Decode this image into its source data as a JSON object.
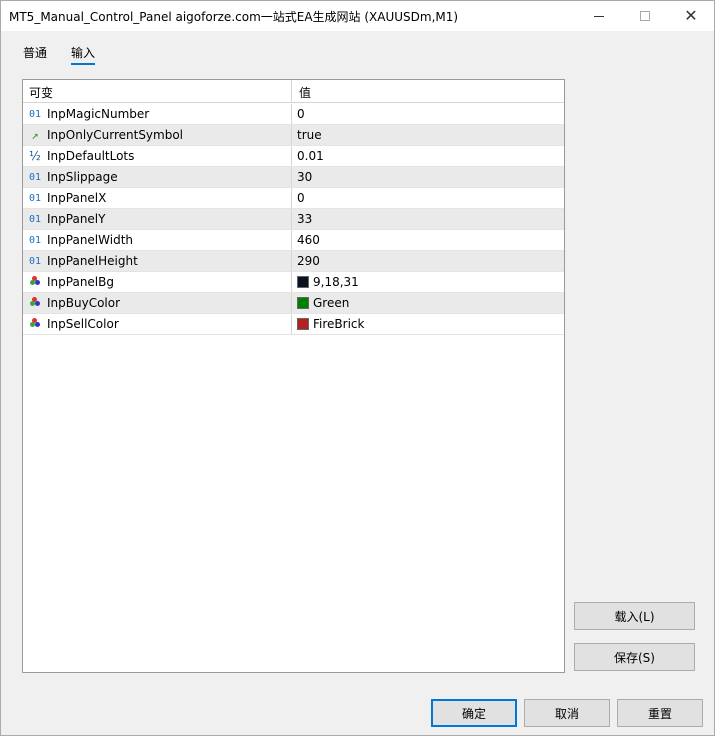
{
  "window": {
    "title": "MT5_Manual_Control_Panel aigoforze.com一站式EA生成网站 (XAUUSDm,M1)",
    "close_glyph": "✕"
  },
  "tabs": [
    {
      "label": "普通",
      "active": false
    },
    {
      "label": "输入",
      "active": true
    }
  ],
  "grid": {
    "headers": {
      "name": "可变",
      "value": "值"
    },
    "rows": [
      {
        "type_icon": "01",
        "icon_name": "integer-icon",
        "name": "InpMagicNumber",
        "value": "0"
      },
      {
        "type_icon": "↗",
        "icon_name": "boolean-icon",
        "name": "InpOnlyCurrentSymbol",
        "value": "true"
      },
      {
        "type_icon": "½",
        "icon_name": "double-icon",
        "name": "InpDefaultLots",
        "value": "0.01"
      },
      {
        "type_icon": "01",
        "icon_name": "integer-icon",
        "name": "InpSlippage",
        "value": "30"
      },
      {
        "type_icon": "01",
        "icon_name": "integer-icon",
        "name": "InpPanelX",
        "value": "0"
      },
      {
        "type_icon": "01",
        "icon_name": "integer-icon",
        "name": "InpPanelY",
        "value": "33"
      },
      {
        "type_icon": "01",
        "icon_name": "integer-icon",
        "name": "InpPanelWidth",
        "value": "460"
      },
      {
        "type_icon": "01",
        "icon_name": "integer-icon",
        "name": "InpPanelHeight",
        "value": "290"
      },
      {
        "type_icon": "",
        "icon_name": "color-icon",
        "name": "InpPanelBg",
        "value": "9,18,31",
        "swatch": "#09121f"
      },
      {
        "type_icon": "",
        "icon_name": "color-icon",
        "name": "InpBuyColor",
        "value": "Green",
        "swatch": "#008000"
      },
      {
        "type_icon": "",
        "icon_name": "color-icon",
        "name": "InpSellColor",
        "value": "FireBrick",
        "swatch": "#b22222"
      }
    ]
  },
  "buttons": {
    "load": "载入(L)",
    "save": "保存(S)",
    "ok": "确定",
    "cancel": "取消",
    "reset": "重置"
  },
  "colors": {
    "accent": "#0078d7"
  }
}
